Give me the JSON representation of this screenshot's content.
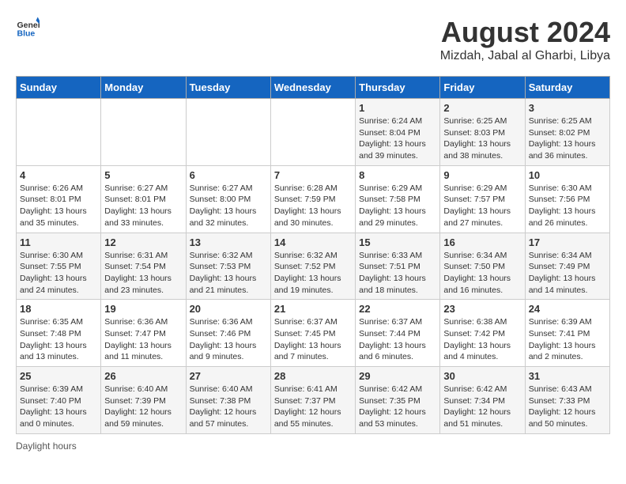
{
  "logo": {
    "text_general": "General",
    "text_blue": "Blue"
  },
  "header": {
    "title": "August 2024",
    "subtitle": "Mizdah, Jabal al Gharbi, Libya"
  },
  "weekdays": [
    "Sunday",
    "Monday",
    "Tuesday",
    "Wednesday",
    "Thursday",
    "Friday",
    "Saturday"
  ],
  "weeks": [
    [
      {
        "day": "",
        "info": ""
      },
      {
        "day": "",
        "info": ""
      },
      {
        "day": "",
        "info": ""
      },
      {
        "day": "",
        "info": ""
      },
      {
        "day": "1",
        "sunrise": "Sunrise: 6:24 AM",
        "sunset": "Sunset: 8:04 PM",
        "daylight": "Daylight: 13 hours and 39 minutes."
      },
      {
        "day": "2",
        "sunrise": "Sunrise: 6:25 AM",
        "sunset": "Sunset: 8:03 PM",
        "daylight": "Daylight: 13 hours and 38 minutes."
      },
      {
        "day": "3",
        "sunrise": "Sunrise: 6:25 AM",
        "sunset": "Sunset: 8:02 PM",
        "daylight": "Daylight: 13 hours and 36 minutes."
      }
    ],
    [
      {
        "day": "4",
        "sunrise": "Sunrise: 6:26 AM",
        "sunset": "Sunset: 8:01 PM",
        "daylight": "Daylight: 13 hours and 35 minutes."
      },
      {
        "day": "5",
        "sunrise": "Sunrise: 6:27 AM",
        "sunset": "Sunset: 8:01 PM",
        "daylight": "Daylight: 13 hours and 33 minutes."
      },
      {
        "day": "6",
        "sunrise": "Sunrise: 6:27 AM",
        "sunset": "Sunset: 8:00 PM",
        "daylight": "Daylight: 13 hours and 32 minutes."
      },
      {
        "day": "7",
        "sunrise": "Sunrise: 6:28 AM",
        "sunset": "Sunset: 7:59 PM",
        "daylight": "Daylight: 13 hours and 30 minutes."
      },
      {
        "day": "8",
        "sunrise": "Sunrise: 6:29 AM",
        "sunset": "Sunset: 7:58 PM",
        "daylight": "Daylight: 13 hours and 29 minutes."
      },
      {
        "day": "9",
        "sunrise": "Sunrise: 6:29 AM",
        "sunset": "Sunset: 7:57 PM",
        "daylight": "Daylight: 13 hours and 27 minutes."
      },
      {
        "day": "10",
        "sunrise": "Sunrise: 6:30 AM",
        "sunset": "Sunset: 7:56 PM",
        "daylight": "Daylight: 13 hours and 26 minutes."
      }
    ],
    [
      {
        "day": "11",
        "sunrise": "Sunrise: 6:30 AM",
        "sunset": "Sunset: 7:55 PM",
        "daylight": "Daylight: 13 hours and 24 minutes."
      },
      {
        "day": "12",
        "sunrise": "Sunrise: 6:31 AM",
        "sunset": "Sunset: 7:54 PM",
        "daylight": "Daylight: 13 hours and 23 minutes."
      },
      {
        "day": "13",
        "sunrise": "Sunrise: 6:32 AM",
        "sunset": "Sunset: 7:53 PM",
        "daylight": "Daylight: 13 hours and 21 minutes."
      },
      {
        "day": "14",
        "sunrise": "Sunrise: 6:32 AM",
        "sunset": "Sunset: 7:52 PM",
        "daylight": "Daylight: 13 hours and 19 minutes."
      },
      {
        "day": "15",
        "sunrise": "Sunrise: 6:33 AM",
        "sunset": "Sunset: 7:51 PM",
        "daylight": "Daylight: 13 hours and 18 minutes."
      },
      {
        "day": "16",
        "sunrise": "Sunrise: 6:34 AM",
        "sunset": "Sunset: 7:50 PM",
        "daylight": "Daylight: 13 hours and 16 minutes."
      },
      {
        "day": "17",
        "sunrise": "Sunrise: 6:34 AM",
        "sunset": "Sunset: 7:49 PM",
        "daylight": "Daylight: 13 hours and 14 minutes."
      }
    ],
    [
      {
        "day": "18",
        "sunrise": "Sunrise: 6:35 AM",
        "sunset": "Sunset: 7:48 PM",
        "daylight": "Daylight: 13 hours and 13 minutes."
      },
      {
        "day": "19",
        "sunrise": "Sunrise: 6:36 AM",
        "sunset": "Sunset: 7:47 PM",
        "daylight": "Daylight: 13 hours and 11 minutes."
      },
      {
        "day": "20",
        "sunrise": "Sunrise: 6:36 AM",
        "sunset": "Sunset: 7:46 PM",
        "daylight": "Daylight: 13 hours and 9 minutes."
      },
      {
        "day": "21",
        "sunrise": "Sunrise: 6:37 AM",
        "sunset": "Sunset: 7:45 PM",
        "daylight": "Daylight: 13 hours and 7 minutes."
      },
      {
        "day": "22",
        "sunrise": "Sunrise: 6:37 AM",
        "sunset": "Sunset: 7:44 PM",
        "daylight": "Daylight: 13 hours and 6 minutes."
      },
      {
        "day": "23",
        "sunrise": "Sunrise: 6:38 AM",
        "sunset": "Sunset: 7:42 PM",
        "daylight": "Daylight: 13 hours and 4 minutes."
      },
      {
        "day": "24",
        "sunrise": "Sunrise: 6:39 AM",
        "sunset": "Sunset: 7:41 PM",
        "daylight": "Daylight: 13 hours and 2 minutes."
      }
    ],
    [
      {
        "day": "25",
        "sunrise": "Sunrise: 6:39 AM",
        "sunset": "Sunset: 7:40 PM",
        "daylight": "Daylight: 13 hours and 0 minutes."
      },
      {
        "day": "26",
        "sunrise": "Sunrise: 6:40 AM",
        "sunset": "Sunset: 7:39 PM",
        "daylight": "Daylight: 12 hours and 59 minutes."
      },
      {
        "day": "27",
        "sunrise": "Sunrise: 6:40 AM",
        "sunset": "Sunset: 7:38 PM",
        "daylight": "Daylight: 12 hours and 57 minutes."
      },
      {
        "day": "28",
        "sunrise": "Sunrise: 6:41 AM",
        "sunset": "Sunset: 7:37 PM",
        "daylight": "Daylight: 12 hours and 55 minutes."
      },
      {
        "day": "29",
        "sunrise": "Sunrise: 6:42 AM",
        "sunset": "Sunset: 7:35 PM",
        "daylight": "Daylight: 12 hours and 53 minutes."
      },
      {
        "day": "30",
        "sunrise": "Sunrise: 6:42 AM",
        "sunset": "Sunset: 7:34 PM",
        "daylight": "Daylight: 12 hours and 51 minutes."
      },
      {
        "day": "31",
        "sunrise": "Sunrise: 6:43 AM",
        "sunset": "Sunset: 7:33 PM",
        "daylight": "Daylight: 12 hours and 50 minutes."
      }
    ]
  ],
  "footer": {
    "note": "Daylight hours"
  }
}
